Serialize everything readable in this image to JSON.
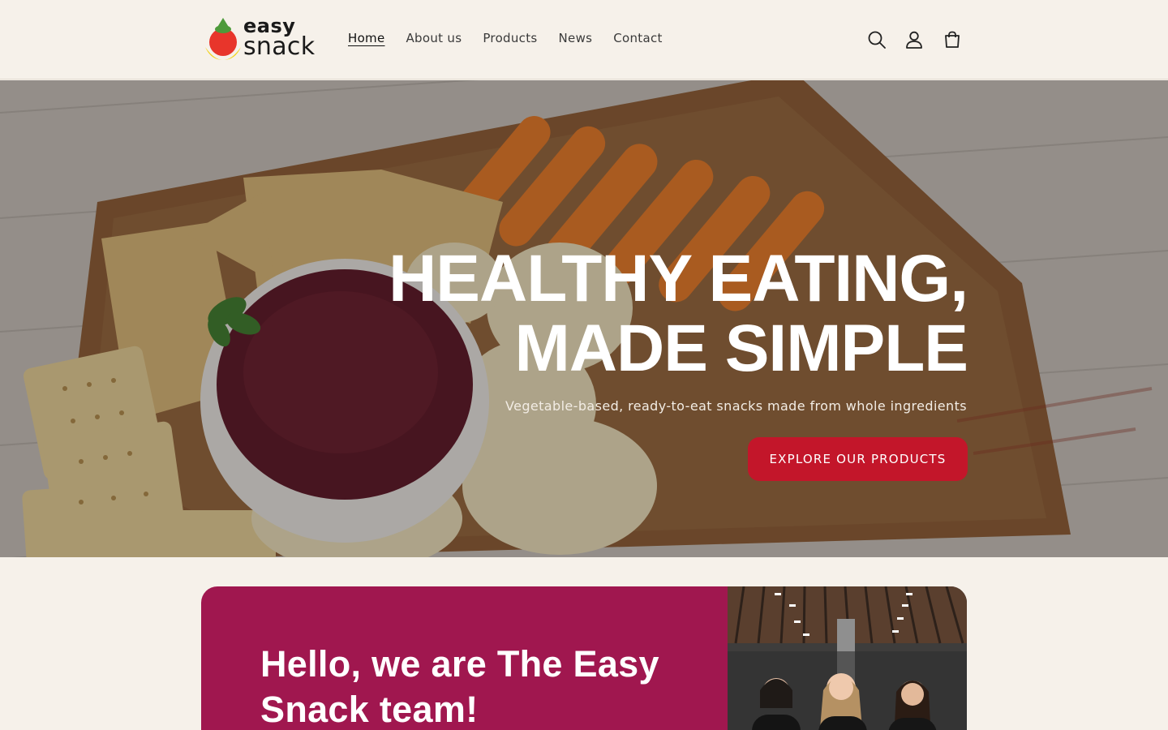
{
  "header": {
    "logo": {
      "line1": "easy",
      "line2": "snack"
    },
    "nav": [
      {
        "label": "Home",
        "active": true
      },
      {
        "label": "About us"
      },
      {
        "label": "Products"
      },
      {
        "label": "News"
      },
      {
        "label": "Contact"
      }
    ],
    "icons": [
      "search-icon",
      "account-icon",
      "cart-icon"
    ]
  },
  "hero": {
    "title_line1": "HEALTHY EATING,",
    "title_line2": "MADE SIMPLE",
    "subtitle": "Vegetable-based, ready-to-eat snacks made from whole ingredients",
    "cta_label": "EXPLORE OUR PRODUCTS"
  },
  "team": {
    "title": "Hello, we are The Easy Snack team!"
  },
  "colors": {
    "background": "#f6f1ea",
    "accent_red": "#c3162a",
    "team_magenta": "#a0174f"
  }
}
